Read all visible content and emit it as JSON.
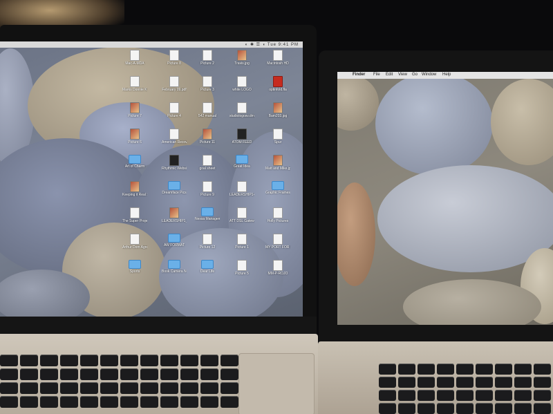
{
  "left_screen": {
    "menubar_tray": "◐ ✱ ☰ ◖ Tue 9:41 PM",
    "icons": [
      {
        "label": "Mac-A-MDA",
        "kind": "doc"
      },
      {
        "label": "Picture 8",
        "kind": "doc"
      },
      {
        "label": "Picture 2",
        "kind": "doc"
      },
      {
        "label": "Travis.jpg",
        "kind": "photo"
      },
      {
        "label": "Macintosh HD",
        "kind": "doc"
      },
      {
        "label": "Marks Donnie Kiang Treatment_1.pdf",
        "kind": "doc"
      },
      {
        "label": "February 09.pdf",
        "kind": "doc"
      },
      {
        "label": "Picture 3",
        "kind": "doc"
      },
      {
        "label": "white LOGO",
        "kind": "doc"
      },
      {
        "label": "optinfold.fla",
        "kind": "red"
      },
      {
        "label": "Picture 7",
        "kind": "photo"
      },
      {
        "label": "Picture 4",
        "kind": "doc"
      },
      {
        "label": "542 manual",
        "kind": "doc"
      },
      {
        "label": "studiologosv.dmg",
        "kind": "doc"
      },
      {
        "label": "Bam203.jpg",
        "kind": "photo"
      },
      {
        "label": "Picture 6",
        "kind": "photo"
      },
      {
        "label": "American Recover & Reinvestment Act",
        "kind": "doc"
      },
      {
        "label": "Picture 11",
        "kind": "photo"
      },
      {
        "label": "ATOM FEED",
        "kind": "dark"
      },
      {
        "label": "Spur",
        "kind": "doc"
      },
      {
        "label": "Art of Charm",
        "kind": "folder"
      },
      {
        "label": "Rhythmic Website",
        "kind": "dark"
      },
      {
        "label": "goal sheet",
        "kind": "doc"
      },
      {
        "label": "Great Idea",
        "kind": "folder"
      },
      {
        "label": "Matt and Mike.jpeg",
        "kind": "photo"
      },
      {
        "label": "Keeping it Real Sports like You",
        "kind": "photo"
      },
      {
        "label": "Dreamface Pics",
        "kind": "folder"
      },
      {
        "label": "Picture 9",
        "kind": "doc"
      },
      {
        "label": "LEADERSHIP1+Card",
        "kind": "doc"
      },
      {
        "label": "Graphic Frames",
        "kind": "folder"
      },
      {
        "label": "The Super Project.pdf",
        "kind": "doc"
      },
      {
        "label": "LEADERSHIP1_Card.pdf",
        "kind": "photo"
      },
      {
        "label": "Nessa Management",
        "kind": "folder"
      },
      {
        "label": "ATT DSL Gateway Construction",
        "kind": "doc"
      },
      {
        "label": "Holly Pictures",
        "kind": "doc"
      },
      {
        "label": "Arthur Dom Agreement",
        "kind": "doc"
      },
      {
        "label": "AW FORMAT",
        "kind": "folder"
      },
      {
        "label": "Picture 12",
        "kind": "doc"
      },
      {
        "label": "Picture 1",
        "kind": "doc"
      },
      {
        "label": "MY PORT FOR SERVER",
        "kind": "doc"
      },
      {
        "label": "Sports",
        "kind": "folder"
      },
      {
        "label": "Book Camera NO",
        "kind": "folder"
      },
      {
        "label": "Dear Life",
        "kind": "folder"
      },
      {
        "label": "Picture 5",
        "kind": "doc"
      },
      {
        "label": "MM-P-ROJO",
        "kind": "doc"
      }
    ]
  },
  "right_screen": {
    "apple_glyph": "",
    "menu": [
      "Finder",
      "File",
      "Edit",
      "View",
      "Go",
      "Window",
      "Help"
    ]
  },
  "colors": {
    "bezel": "#111111",
    "aluminum": "#c6bdae",
    "folder": "#6ab0e8",
    "stone_blue": "#9aa3b8",
    "stone_beige": "#b8ad9b"
  }
}
